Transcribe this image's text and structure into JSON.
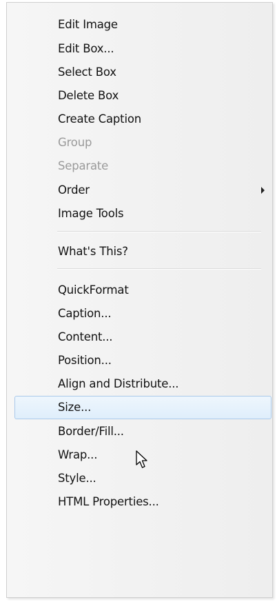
{
  "context_menu": {
    "items": [
      {
        "label": "Edit Image",
        "enabled": true
      },
      {
        "label": "Edit Box...",
        "enabled": true
      },
      {
        "label": "Select Box",
        "enabled": true
      },
      {
        "label": "Delete Box",
        "enabled": true
      },
      {
        "label": "Create Caption",
        "enabled": true
      },
      {
        "label": "Group",
        "enabled": false
      },
      {
        "label": "Separate",
        "enabled": false
      },
      {
        "label": "Order",
        "enabled": true,
        "submenu": true
      },
      {
        "label": "Image Tools",
        "enabled": true
      },
      {
        "label": "What's This?",
        "enabled": true
      },
      {
        "label": "QuickFormat",
        "enabled": true
      },
      {
        "label": "Caption...",
        "enabled": true
      },
      {
        "label": "Content...",
        "enabled": true
      },
      {
        "label": "Position...",
        "enabled": true
      },
      {
        "label": "Align and Distribute...",
        "enabled": true
      },
      {
        "label": "Size...",
        "enabled": true,
        "highlighted": true
      },
      {
        "label": "Border/Fill...",
        "enabled": true
      },
      {
        "label": "Wrap...",
        "enabled": true
      },
      {
        "label": "Style...",
        "enabled": true
      },
      {
        "label": "HTML Properties...",
        "enabled": true
      }
    ],
    "highlight_color": "#dfeefb",
    "disabled_text_color": "#9a9a9a"
  },
  "cursor": {
    "icon": "arrow-pointer-icon"
  }
}
